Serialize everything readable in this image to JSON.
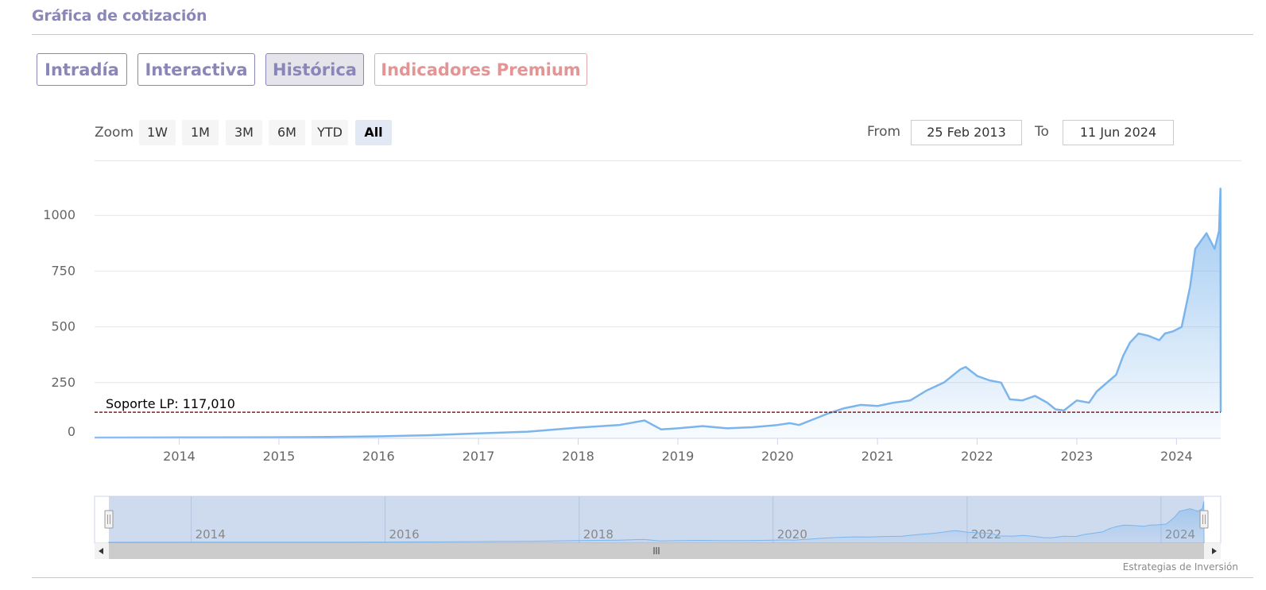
{
  "page": {
    "title": "Gráfica de cotización",
    "credit": "Estrategias de Inversión"
  },
  "tabs": [
    {
      "label": "Intradía",
      "active": false
    },
    {
      "label": "Interactiva",
      "active": false
    },
    {
      "label": "Histórica",
      "active": true
    },
    {
      "label": "Indicadores Premium",
      "active": false,
      "premium": true
    }
  ],
  "zoom": {
    "label": "Zoom",
    "buttons": [
      "1W",
      "1M",
      "3M",
      "6M",
      "YTD",
      "All"
    ],
    "selected": "All"
  },
  "range": {
    "from_label": "From",
    "from_value": "25 Feb 2013",
    "to_label": "To",
    "to_value": "11 Jun 2024"
  },
  "colors": {
    "accent": "#8a86b8",
    "premium": "#e39494",
    "series_line": "#7cb5ec",
    "support_line": "#8b1a1a",
    "navigator_mask": "#c6d5ec"
  },
  "chart_data": {
    "type": "area",
    "title": "",
    "xlabel": "",
    "ylabel": "",
    "x_range": [
      "2013-02-25",
      "2024-06-11"
    ],
    "ylim": [
      0,
      1150
    ],
    "y_ticks": [
      0,
      250,
      500,
      750,
      1000
    ],
    "x_ticks": [
      "2014",
      "2015",
      "2016",
      "2017",
      "2018",
      "2019",
      "2020",
      "2021",
      "2022",
      "2023",
      "2024"
    ],
    "navigator_ticks": [
      "2014",
      "2016",
      "2018",
      "2020",
      "2022",
      "2024"
    ],
    "grid": true,
    "annotation": {
      "label": "Soporte LP: 117,010",
      "value": 117.01
    },
    "series": [
      {
        "x": [
          "2013-02-25",
          "2014-01-01",
          "2015-01-01",
          "2015-07-01",
          "2016-01-01",
          "2016-07-01",
          "2017-01-01",
          "2017-07-01",
          "2018-01-01",
          "2018-06-01",
          "2018-09-01",
          "2018-11-01",
          "2019-01-01",
          "2019-04-01",
          "2019-07-01",
          "2019-10-01",
          "2020-01-01",
          "2020-02-15",
          "2020-03-20",
          "2020-05-01",
          "2020-07-01",
          "2020-09-01",
          "2020-11-01",
          "2021-01-01",
          "2021-03-01",
          "2021-05-01",
          "2021-07-01",
          "2021-09-01",
          "2021-11-01",
          "2021-11-20",
          "2022-01-01",
          "2022-02-15",
          "2022-03-30",
          "2022-05-01",
          "2022-06-15",
          "2022-08-01",
          "2022-09-15",
          "2022-10-15",
          "2022-11-15",
          "2023-01-01",
          "2023-02-15",
          "2023-03-15",
          "2023-05-01",
          "2023-05-25",
          "2023-06-20",
          "2023-07-15",
          "2023-08-15",
          "2023-09-20",
          "2023-10-30",
          "2023-11-20",
          "2023-12-20",
          "2024-01-20",
          "2024-02-20",
          "2024-03-10",
          "2024-04-20",
          "2024-05-20",
          "2024-06-05",
          "2024-06-10",
          "2024-06-11"
        ],
        "y": [
          3,
          4,
          5,
          6,
          9,
          14,
          22,
          30,
          48,
          60,
          80,
          40,
          45,
          55,
          45,
          50,
          60,
          68,
          60,
          80,
          110,
          135,
          150,
          145,
          160,
          170,
          215,
          250,
          310,
          320,
          280,
          260,
          250,
          175,
          170,
          190,
          160,
          130,
          125,
          170,
          160,
          210,
          260,
          285,
          370,
          430,
          470,
          460,
          440,
          470,
          480,
          500,
          680,
          850,
          920,
          850,
          930,
          1120,
          117
        ]
      }
    ]
  }
}
